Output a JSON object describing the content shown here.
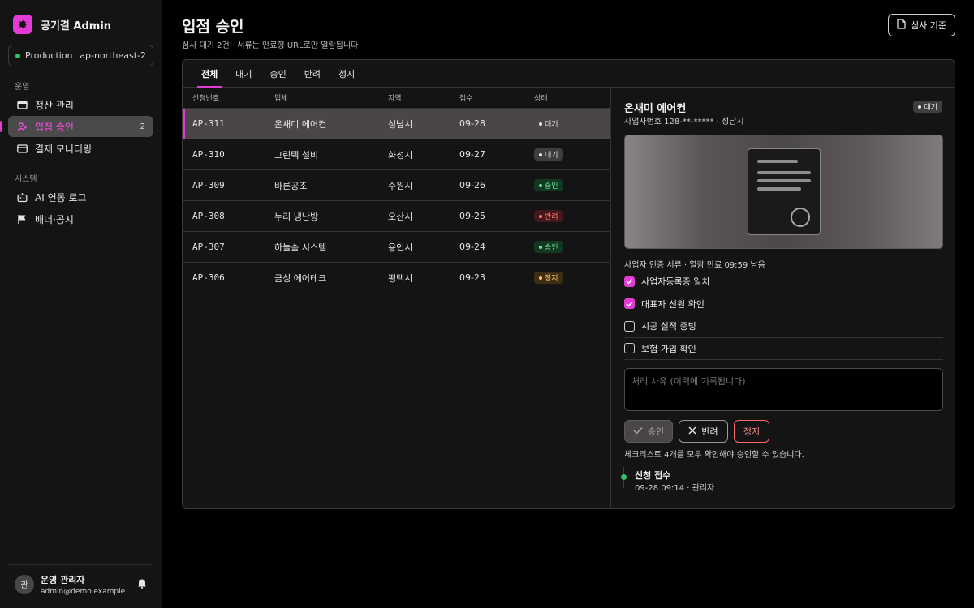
{
  "brand": {
    "name": "공기결 Admin"
  },
  "environment": {
    "name": "Production",
    "region": "ap-northeast-2"
  },
  "nav": {
    "groups": [
      {
        "label": "운영",
        "items": [
          {
            "label": "정산 관리",
            "icon": "wallet-icon",
            "count": ""
          },
          {
            "label": "입점 승인",
            "icon": "approval-icon",
            "count": "2"
          },
          {
            "label": "결제 모니터링",
            "icon": "card-icon",
            "count": ""
          }
        ]
      },
      {
        "label": "시스템",
        "items": [
          {
            "label": "AI 연동 로그",
            "icon": "robot-icon",
            "count": ""
          },
          {
            "label": "배너·공지",
            "icon": "flag-icon",
            "count": ""
          }
        ]
      }
    ]
  },
  "user": {
    "avatar": "관",
    "name": "운영 관리자",
    "email": "admin@demo.example"
  },
  "page": {
    "title": "입점 승인",
    "subtitle": "심사 대기 2건 · 서류는 만료형 URL로만 열람됩니다",
    "criteria_label": "심사 기준"
  },
  "tabs": [
    "전체",
    "대기",
    "승인",
    "반려",
    "정지"
  ],
  "table": {
    "headers": [
      "신청번호",
      "업체",
      "지역",
      "접수",
      "상태"
    ],
    "rows": [
      {
        "id": "AP-311",
        "company": "온새미 에어컨",
        "region": "성남시",
        "date": "09-28",
        "status": "대기"
      },
      {
        "id": "AP-310",
        "company": "그린텍 설비",
        "region": "화성시",
        "date": "09-27",
        "status": "대기"
      },
      {
        "id": "AP-309",
        "company": "바른공조",
        "region": "수원시",
        "date": "09-26",
        "status": "승인"
      },
      {
        "id": "AP-308",
        "company": "누리 냉난방",
        "region": "오산시",
        "date": "09-25",
        "status": "반려"
      },
      {
        "id": "AP-307",
        "company": "하늘숨 시스템",
        "region": "용인시",
        "date": "09-24",
        "status": "승인"
      },
      {
        "id": "AP-306",
        "company": "금성 에어테크",
        "region": "평택시",
        "date": "09-23",
        "status": "정지"
      }
    ]
  },
  "detail": {
    "name": "온새미 에어컨",
    "meta": "사업자번호 128-**-***** · 성남시",
    "status": "대기",
    "doc_label": "사업자 인증 서류 · 열람 만료 09:59 남음",
    "checklist": [
      {
        "label": "사업자등록증 일치",
        "checked": true
      },
      {
        "label": "대표자 신원 확인",
        "checked": true
      },
      {
        "label": "시공 실적 증빙",
        "checked": false
      },
      {
        "label": "보험 가입 확인",
        "checked": false
      }
    ],
    "reason_placeholder": "처리 사유 (이력에 기록됩니다)",
    "approve_label": "승인",
    "reject_label": "반려",
    "stop_label": "정지",
    "hint": "체크리스트 4개를 모두 확인해야 승인할 수 있습니다.",
    "timeline": [
      {
        "title": "신청 접수",
        "sub": "09-28 09:14 · 관리자"
      }
    ]
  },
  "colors": {
    "accent": "#e33bd6",
    "success": "#2fc46a",
    "danger": "#ff6a6a",
    "warning": "#ffc566"
  }
}
